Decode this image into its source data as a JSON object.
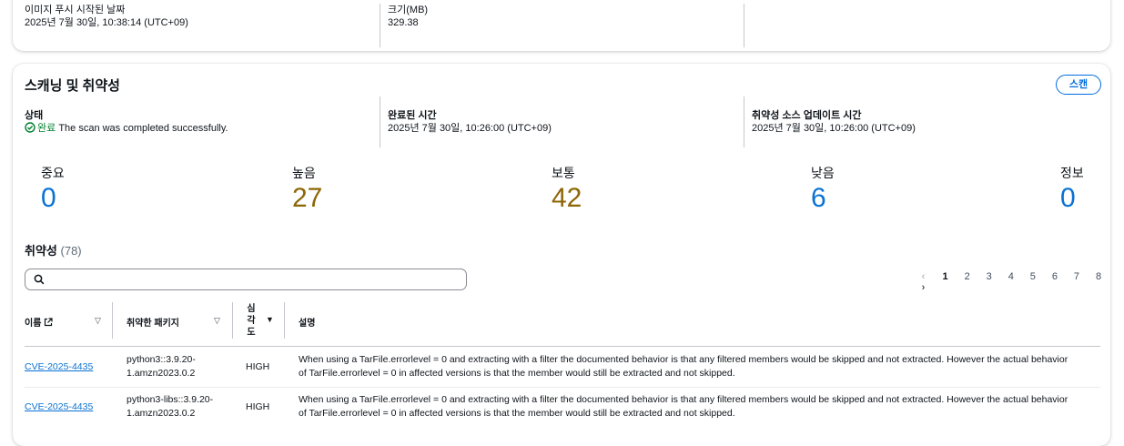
{
  "top": {
    "created_label": "이미지 푸시 시작된 날짜",
    "created_value": "2025년 7월 30일, 10:38:14 (UTC+09)",
    "size_label": "크기(MB)",
    "size_value": "329.38"
  },
  "scan": {
    "title": "스캐닝 및 취약성",
    "scan_button": "스캔",
    "status_label": "상태",
    "status_value": "완료",
    "status_message": "The scan was completed successfully.",
    "completed_label": "완료된 시간",
    "completed_value": "2025년 7월 30일, 10:26:00 (UTC+09)",
    "source_label": "취약성 소스 업데이트 시간",
    "source_value": "2025년 7월 30일, 10:26:00 (UTC+09)"
  },
  "severity": [
    {
      "label": "중요",
      "count": "0"
    },
    {
      "label": "높음",
      "count": "27"
    },
    {
      "label": "보통",
      "count": "42"
    },
    {
      "label": "낮음",
      "count": "6"
    },
    {
      "label": "정보",
      "count": "0"
    }
  ],
  "colors": {
    "info": "#0972d3",
    "warning": "#8d6605",
    "success": "#00802f"
  },
  "vulnerabilities": {
    "heading": "취약성",
    "count": "(78)",
    "search_placeholder": "",
    "pages": [
      "1",
      "2",
      "3",
      "4",
      "5",
      "6",
      "7",
      "8"
    ],
    "current_page": "1",
    "columns": {
      "name": "이름",
      "package": "취약한 패키지",
      "severity": "심\n각\n도",
      "description": "설명"
    },
    "rows": [
      {
        "name": "CVE-2025-4435",
        "package": "python3::3.9.20-1.amzn2023.0.2",
        "severity": "HIGH",
        "description": "When using a TarFile.errorlevel = 0 and extracting with a filter the documented behavior is that any filtered members would be skipped and not extracted. However the actual behavior of TarFile.errorlevel = 0 in affected versions is that the member would still be extracted and not skipped."
      },
      {
        "name": "CVE-2025-4435",
        "package": "python3-libs::3.9.20-1.amzn2023.0.2",
        "severity": "HIGH",
        "description": "When using a TarFile.errorlevel = 0 and extracting with a filter the documented behavior is that any filtered members would be skipped and not extracted. However the actual behavior of TarFile.errorlevel = 0 in affected versions is that the member would still be extracted and not skipped."
      }
    ]
  }
}
